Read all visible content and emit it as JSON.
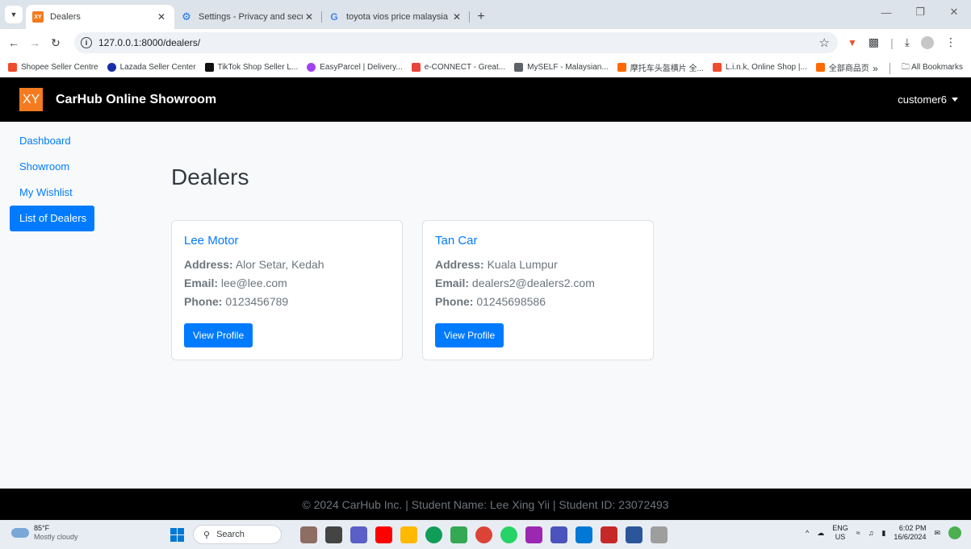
{
  "browser": {
    "tabs": [
      {
        "title": "Dealers",
        "favicon_text": "XY",
        "favicon_color": "#f47b20",
        "active": true
      },
      {
        "title": "Settings - Privacy and security",
        "favicon_text": "⚙",
        "favicon_color": "#1a73e8",
        "active": false
      },
      {
        "title": "toyota vios price malaysia - Goo",
        "favicon_text": "G",
        "favicon_color": "#4285f4",
        "active": false
      }
    ],
    "url": "127.0.0.1:8000/dealers/",
    "bookmarks": [
      {
        "label": "Shopee Seller Centre",
        "color": "#ee4d2d"
      },
      {
        "label": "Lazada Seller Center",
        "color": "#1a2ea8"
      },
      {
        "label": "TikTok Shop Seller L...",
        "color": "#111111"
      },
      {
        "label": "EasyParcel | Delivery...",
        "color": "#a142f4"
      },
      {
        "label": "e-CONNECT - Great...",
        "color": "#e8453c"
      },
      {
        "label": "MySELF - Malaysian...",
        "color": "#5f6368"
      },
      {
        "label": "摩托车头盔横片 全...",
        "color": "#ff6a00"
      },
      {
        "label": "L.i.n.k, Online Shop |...",
        "color": "#ee4d2d"
      },
      {
        "label": "全部商品页",
        "color": "#ff6a00"
      }
    ],
    "all_bookmarks": "All Bookmarks"
  },
  "app": {
    "logo_text": "XY",
    "brand": "CarHub Online Showroom",
    "user": "customer6"
  },
  "sidebar": {
    "items": [
      {
        "label": "Dashboard",
        "active": false
      },
      {
        "label": "Showroom",
        "active": false
      },
      {
        "label": "My Wishlist",
        "active": false
      },
      {
        "label": "List of Dealers",
        "active": true
      }
    ]
  },
  "main": {
    "title": "Dealers",
    "address_label": "Address:",
    "email_label": "Email:",
    "phone_label": "Phone:",
    "button_label": "View Profile",
    "dealers": [
      {
        "name": "Lee Motor",
        "address": "Alor Setar, Kedah",
        "email": "lee@lee.com",
        "phone": "0123456789"
      },
      {
        "name": "Tan Car",
        "address": "Kuala Lumpur",
        "email": "dealers2@dealers2.com",
        "phone": "01245698586"
      }
    ]
  },
  "footer": {
    "text": "© 2024 CarHub Inc. | Student Name: Lee Xing Yii | Student ID: 23072493"
  },
  "taskbar": {
    "weather_temp": "85°F",
    "weather_desc": "Mostly cloudy",
    "search_placeholder": "Search",
    "lang_top": "ENG",
    "lang_bottom": "US",
    "time": "6:02 PM",
    "date": "16/6/2024"
  },
  "colors": {
    "primary": "#007bff",
    "navbar": "#000000",
    "logo": "#f47b20"
  }
}
